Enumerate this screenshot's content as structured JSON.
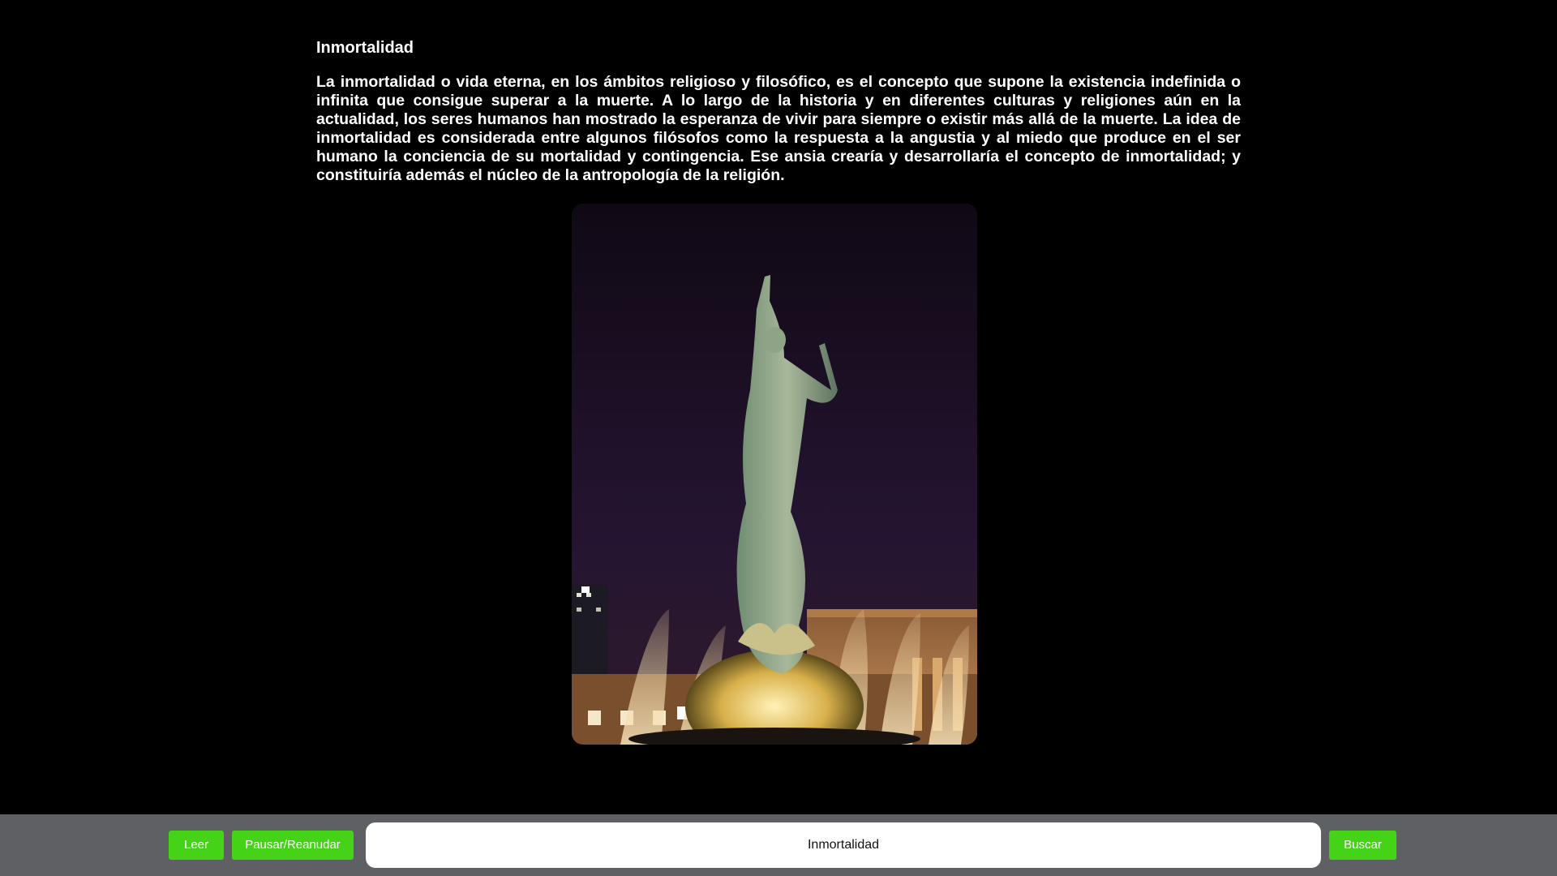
{
  "article": {
    "title": "Inmortalidad",
    "body": "La inmortalidad o vida eterna, en los ámbitos religioso y filosófico, es el concepto que supone la existencia indefinida o infinita que consigue superar a la muerte. A lo largo de la historia y en diferentes culturas y religiones aún en la actualidad, los seres humanos han mostrado la esperanza de vivir para siempre o existir más allá de la muerte. La idea de inmortalidad es considerada entre algunos filósofos como la respuesta a la angustia y al miedo que produce en el ser humano la conciencia de su mortalidad y contingencia. Ese ansia crearía y desarrollaría el concepto de inmortalidad; y constituiría además el núcleo de la antropología de la religión."
  },
  "image": {
    "subject": "statue-fountain-night"
  },
  "toolbar": {
    "read_label": "Leer",
    "pause_label": "Pausar/Reanudar",
    "search_value": "Inmortalidad",
    "search_label": "Buscar"
  },
  "colors": {
    "background": "#000000",
    "bar": "#5e6064",
    "button": "#45d318"
  }
}
